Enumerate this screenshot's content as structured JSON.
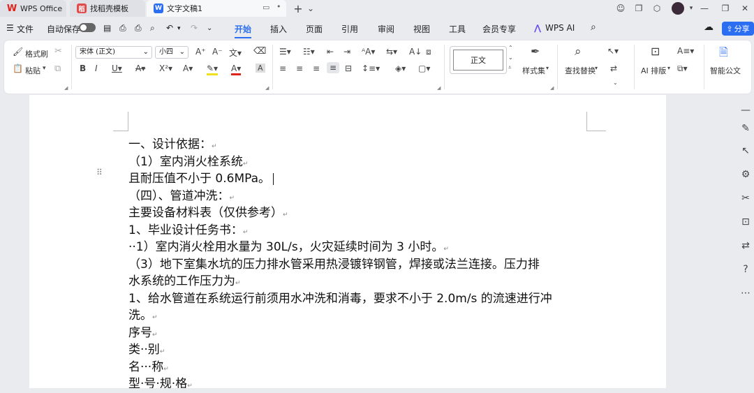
{
  "titlebar": {
    "tabs": [
      {
        "label": "WPS Office",
        "icon": "wps-logo-icon",
        "color": "#e0231a"
      },
      {
        "label": "找稻壳模板",
        "icon": "docer-icon",
        "color": "#e24b4b"
      },
      {
        "label": "文字文稿1",
        "icon": "writer-doc-icon",
        "color": "#2b6ef2"
      }
    ],
    "new_tab": "+",
    "tab_menu": "⌄"
  },
  "menubar": {
    "file": "文件",
    "autosave": "自动保存",
    "tabs": [
      "开始",
      "插入",
      "页面",
      "引用",
      "审阅",
      "视图",
      "工具",
      "会员专享"
    ],
    "active_tab": "开始",
    "ai": "WPS AI",
    "share": "分享"
  },
  "ribbon": {
    "format_painter": "格式刷",
    "paste": "粘贴",
    "font_name": "宋体 (正文)",
    "font_size": "小四",
    "style_preview": "正文",
    "styles": "样式集",
    "find_replace": "查找替换",
    "ai_layout": "AI 排版",
    "smart_doc": "智能公文"
  },
  "document": {
    "lines": [
      "一、设计依据：",
      "（1）室内消火栓系统",
      "且耐压值不小于 0.6MPa。",
      "（四）、管道冲洗：",
      "主要设备材料表（仅供参考）",
      "1、毕业设计任务书：",
      "··1）室内消火栓用水量为 30L/s，火灾延续时间为 3 小时。",
      "（3）地下室集水坑的压力排水管采用热浸镀锌钢管，焊接或法兰连接。压力排",
      "水系统的工作压力为",
      "1、给水管道在系统运行前须用水冲洗和消毒，要求不小于 2.0m/s 的流速进行冲",
      "洗。",
      "序号",
      "类··别",
      "名···称",
      "型·号·规·格"
    ],
    "para_mark": "↵"
  },
  "colors": {
    "accent": "#2b6ef2",
    "active_tab": "#2b6ef2",
    "wps_red": "#e0231a"
  }
}
